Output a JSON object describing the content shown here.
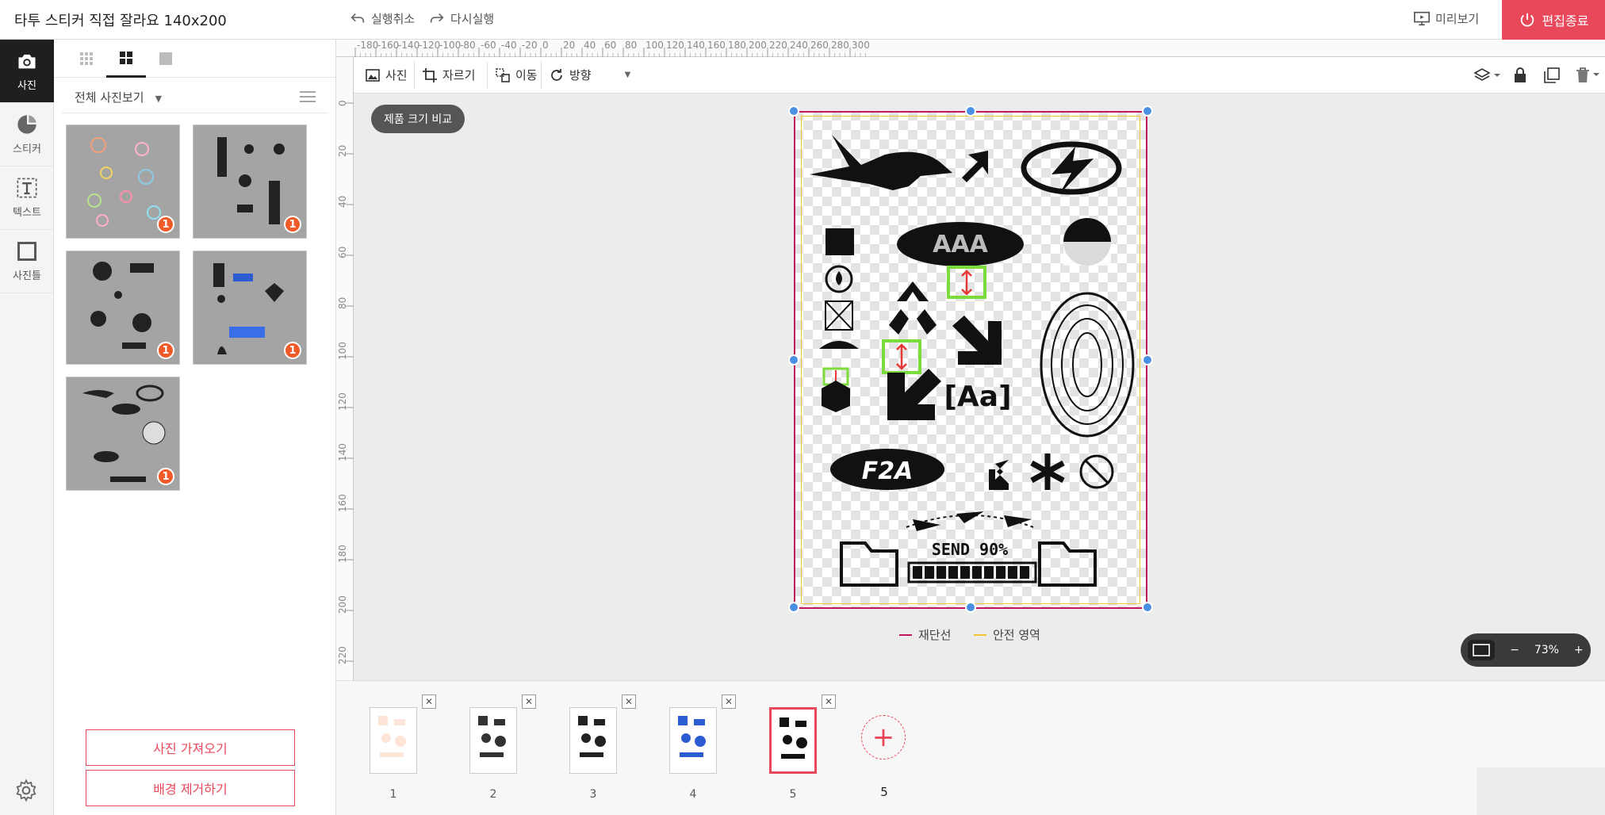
{
  "header": {
    "title": "타투 스티커 직접 잘라요 140x200",
    "undo": "실행취소",
    "redo": "다시실행",
    "preview": "미리보기",
    "exit": "편집종료"
  },
  "nav": [
    {
      "label": "사진",
      "icon": "camera-icon"
    },
    {
      "label": "스티커",
      "icon": "sticker-icon"
    },
    {
      "label": "텍스트",
      "icon": "text-icon"
    },
    {
      "label": "사진틀",
      "icon": "frame-icon"
    }
  ],
  "panel": {
    "filter": "전체 사진보기",
    "photos": [
      {
        "badge": "1"
      },
      {
        "badge": "1"
      },
      {
        "badge": "1"
      },
      {
        "badge": "1"
      },
      {
        "badge": "1"
      }
    ],
    "import_button": "사진 가져오기",
    "remove_bg_button": "배경 제거하기"
  },
  "ruler": {
    "top_ticks": [
      "-180",
      "-160",
      "-140",
      "-120",
      "-100",
      "-80",
      "-60",
      "-40",
      "-20",
      "0",
      "20",
      "40",
      "60",
      "80",
      "100",
      "120",
      "140",
      "160",
      "180",
      "200",
      "220",
      "240",
      "260",
      "280",
      "300"
    ],
    "left_ticks": [
      "0",
      "20",
      "40",
      "60",
      "80",
      "100",
      "120",
      "140",
      "160",
      "180",
      "200",
      "220"
    ]
  },
  "toolbar": {
    "photo": "사진",
    "crop": "자르기",
    "move": "이동",
    "direction": "방향"
  },
  "canvas": {
    "compare_button": "제품 크기 비교",
    "legend_cut": "재단선",
    "legend_safe": "안전 영역",
    "cut_color": "#c2185b",
    "safe_color": "#f4c430",
    "send_text": "SEND 90%",
    "aaa_text": "AAA",
    "aa_text": "[Aa]",
    "f2a_text": "F2A"
  },
  "zoom": {
    "level": "73%"
  },
  "pages": {
    "items": [
      "1",
      "2",
      "3",
      "4",
      "5"
    ],
    "count": "5"
  },
  "colors": {
    "accent": "#e8485a",
    "handle": "#4a90e2"
  }
}
